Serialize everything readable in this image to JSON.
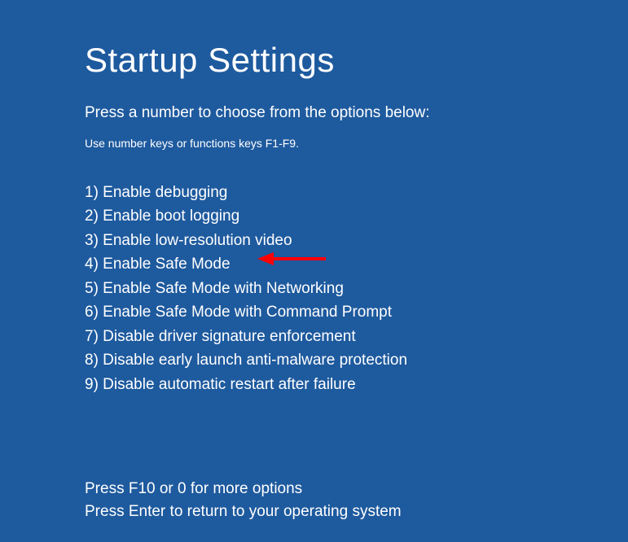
{
  "title": "Startup Settings",
  "subtitle": "Press a number to choose from the options below:",
  "hint": "Use number keys or functions keys F1-F9.",
  "options": [
    "1) Enable debugging",
    "2) Enable boot logging",
    "3) Enable low-resolution video",
    "4) Enable Safe Mode",
    "5) Enable Safe Mode with Networking",
    "6) Enable Safe Mode with Command Prompt",
    "7) Disable driver signature enforcement",
    "8) Disable early launch anti-malware protection",
    "9) Disable automatic restart after failure"
  ],
  "footer": {
    "more": "Press F10 or 0 for more options",
    "return": "Press Enter to return to your operating system"
  },
  "annotation": {
    "arrow_color": "#ff0000",
    "points_to_option_index": 3
  }
}
